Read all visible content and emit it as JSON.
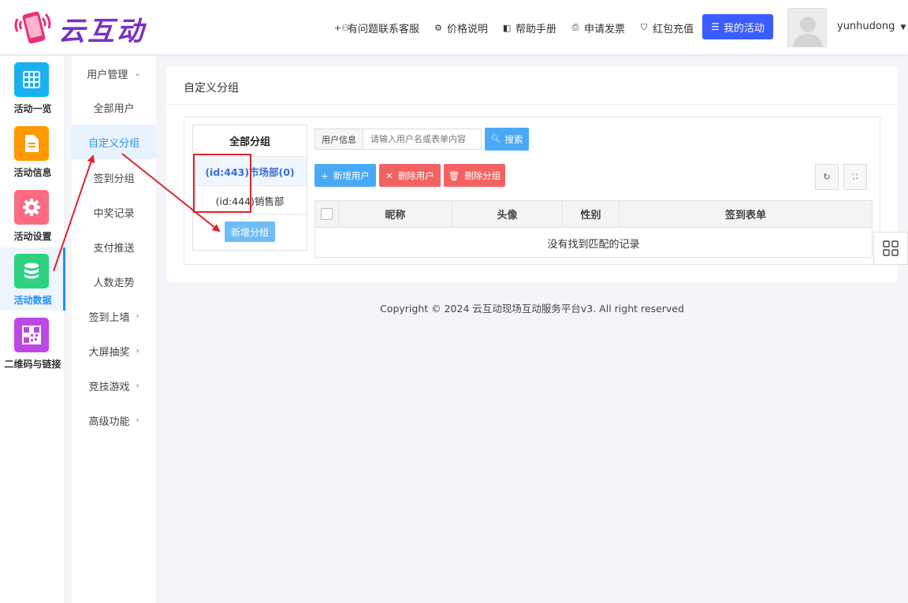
{
  "brand": {
    "name": "云互动"
  },
  "top_nav": {
    "items": [
      {
        "icon": "user-plus-icon",
        "glyph": "+⚇",
        "label": "有问题联系客服"
      },
      {
        "icon": "gear-icon",
        "glyph": "⚙",
        "label": "价格说明"
      },
      {
        "icon": "book-icon",
        "glyph": "◧",
        "label": "帮助手册"
      },
      {
        "icon": "printer-icon",
        "glyph": "⎙",
        "label": "申请发票"
      },
      {
        "icon": "shield-icon",
        "glyph": "⛉",
        "label": "红包充值"
      }
    ],
    "my_activity": "我的活动",
    "username": "yunhudong",
    "accent": "#3b5cff"
  },
  "left_bar": {
    "items": [
      {
        "label": "活动一览",
        "icon": "grid-icon",
        "color": "#1ab0f0"
      },
      {
        "label": "活动信息",
        "icon": "document-icon",
        "color": "#ff9900"
      },
      {
        "label": "活动设置",
        "icon": "gear-icon",
        "color": "#ff6b81"
      },
      {
        "label": "活动数据",
        "icon": "database-icon",
        "color": "#2fd280",
        "active": true
      },
      {
        "label": "二维码与链接",
        "icon": "qrcode-icon",
        "color": "#c046e8"
      }
    ]
  },
  "sub_nav": {
    "items": [
      {
        "label": "用户管理",
        "chev": "⌄"
      },
      {
        "label": "全部用户",
        "chev": ""
      },
      {
        "label": "自定义分组",
        "chev": "",
        "active": true
      },
      {
        "label": "签到分组",
        "chev": ""
      },
      {
        "label": "中奖记录",
        "chev": ""
      },
      {
        "label": "支付推送",
        "chev": ""
      },
      {
        "label": "人数走势",
        "chev": ""
      },
      {
        "label": "签到上墙",
        "chev": "›"
      },
      {
        "label": "大屏抽奖",
        "chev": "›"
      },
      {
        "label": "竞技游戏",
        "chev": "›"
      },
      {
        "label": "高级功能",
        "chev": "›"
      }
    ]
  },
  "panel": {
    "title": "自定义分组",
    "groups": {
      "header": "全部分组",
      "rows": [
        "(id:443)市场部(0)",
        "(id:444)销售部"
      ],
      "add_button": "新增分组"
    },
    "search": {
      "label": "用户信息",
      "placeholder": "请输入用户名或表单内容",
      "button": "搜索"
    },
    "toolbar": {
      "add_user": "新增用户",
      "delete_user": "删除用户",
      "delete_group": "删除分组"
    },
    "table": {
      "columns": [
        "昵称",
        "头像",
        "性别",
        "签到表单"
      ],
      "empty_text": "没有找到匹配的记录"
    }
  },
  "footer": {
    "text": "Copyright © 2024 云互动现场互动服务平台v3. All right reserved"
  }
}
